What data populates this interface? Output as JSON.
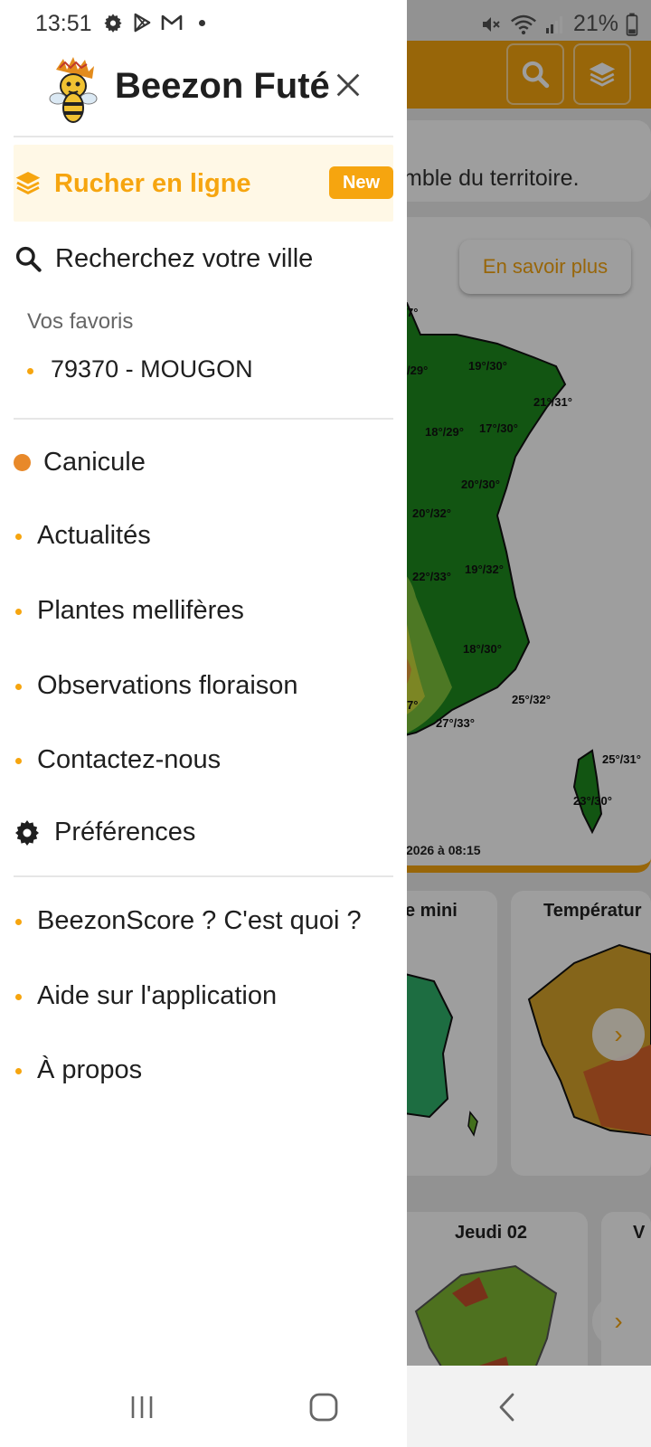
{
  "status_bar": {
    "time": "13:51",
    "battery": "21%",
    "icons_left": [
      "gear-icon",
      "play-store-icon",
      "gmail-icon",
      "notification-dot-icon"
    ],
    "icons_right": [
      "mute-icon",
      "wifi-icon",
      "signal-icon",
      "battery-icon"
    ]
  },
  "drawer": {
    "app_name": "Beezon Futé",
    "featured": {
      "label": "Rucher en ligne",
      "badge": "New",
      "icon": "layers-icon"
    },
    "search": {
      "label": "Recherchez votre ville",
      "icon": "search-icon"
    },
    "favorites": {
      "title": "Vos favoris",
      "items": [
        "79370 - MOUGON"
      ]
    },
    "menu_primary": [
      {
        "label": "Canicule",
        "marker": "large-dot"
      },
      {
        "label": "Actualités",
        "marker": "dot"
      },
      {
        "label": "Plantes mellifères",
        "marker": "dot"
      },
      {
        "label": "Observations floraison",
        "marker": "dot"
      },
      {
        "label": "Contactez-nous",
        "marker": "dot"
      },
      {
        "label": "Préférences",
        "marker": "gear-icon"
      }
    ],
    "menu_secondary": [
      {
        "label": "BeezonScore ? C'est quoi ?"
      },
      {
        "label": "Aide sur l'application"
      },
      {
        "label": "À propos"
      }
    ]
  },
  "background_app": {
    "toolbar_icons": [
      "search-icon",
      "layers-icon"
    ],
    "info_text": "mble du territoire.",
    "more_button": "En savoir plus",
    "map_date": "2026 à 08:15",
    "map_labels": [
      "7°",
      "/29°",
      "19°/30°",
      "21°/31°",
      "18°/29°",
      "17°/30°",
      "20°/30°",
      "20°/32°",
      "22°/33°",
      "19°/32°",
      "18°/30°",
      "7°",
      "27°/33°",
      "25°/32°",
      "25°/31°",
      "23°/30°"
    ],
    "mini_cards": [
      "e mini",
      "Températur",
      "Jeudi 02",
      "V"
    ]
  },
  "colors": {
    "accent": "#f6a50f",
    "canicule": "#e8892a",
    "featured_bg": "#fff8e6"
  }
}
